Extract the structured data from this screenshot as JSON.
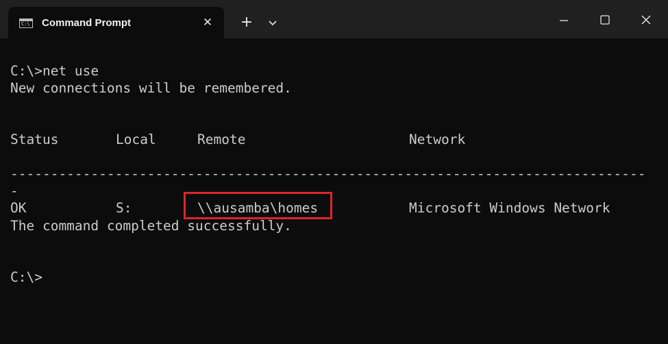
{
  "window": {
    "tab_title": "Command Prompt",
    "tab_icon": "cmd-icon",
    "tab_icon_text": "C:\\",
    "close_tab_symbol": "✕",
    "new_tab_symbol": "+"
  },
  "console": {
    "prompt_line_1": "C:\\>net use",
    "message_1": "New connections will be remembered.",
    "table": {
      "headers": {
        "status": "Status",
        "local": "Local",
        "remote": "Remote",
        "network": "Network"
      },
      "separator": "-------------------------------------------------------------------------------",
      "separator_wrap": "-",
      "rows": [
        {
          "status": "OK",
          "local": "S:",
          "remote": "\\\\ausamba\\homes",
          "network": "Microsoft Windows Network"
        }
      ]
    },
    "message_2": "The command completed successfully.",
    "prompt_line_2": "C:\\>"
  },
  "colors": {
    "console_background": "#0c0c0c",
    "console_text": "#cccccc",
    "titlebar": "#202020",
    "highlight": "#e0242a"
  }
}
